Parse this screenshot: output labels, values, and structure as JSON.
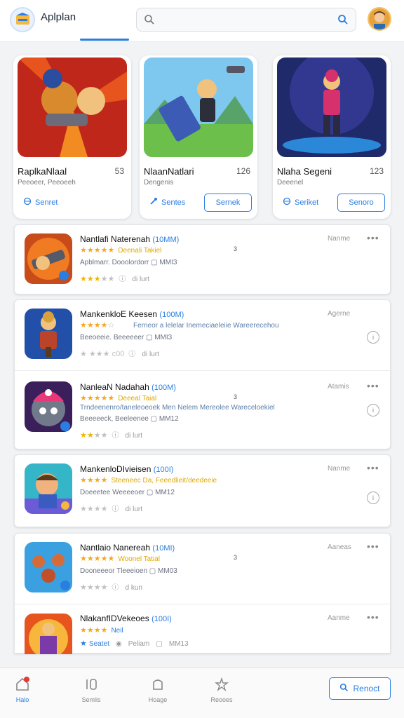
{
  "header": {
    "app_name": "Aplplan",
    "search_placeholder": ""
  },
  "featured": [
    {
      "title": "RaplkaNlaal",
      "number": "53",
      "sub": "Peeoeer, Peeoeeh",
      "link_label": "Senret",
      "button_label": ""
    },
    {
      "title": "NlaanNatlari",
      "number": "126",
      "sub": "Dengenis",
      "link_label": "Sentes",
      "button_label": "Sernek"
    },
    {
      "title": "Nlaha Segeni",
      "number": "123",
      "sub": "Deeenel",
      "link_label": "Seriket",
      "button_label": "Senoro"
    }
  ],
  "list": [
    {
      "title": "Nantlafi Naterenah",
      "title_accent": "(10MM)",
      "tag": "Nanme",
      "stars": "★★★★★",
      "highlight": "Deenali Takiel",
      "side": "3",
      "meta": "Apblmarr. Dooolordorr",
      "size": "MMI3",
      "rating_full": "★★★",
      "rating_empty": "★★",
      "rating_info": "di lurt"
    },
    {
      "title": "MankenkloE Keesen",
      "title_accent": "(100M)",
      "tag": "Agerne",
      "stars": "★★★★",
      "stars_dim": "☆",
      "desc": "Ferneor a lelelar Inemeciaeleiie Wareerecehou",
      "meta": "Beeoeeie. Beeeeeer",
      "size": "MMI3",
      "rating_full": "★",
      "rating_empty": "★★★",
      "rating_extra": "c00",
      "rating_info": "di lurt"
    },
    {
      "title": "NanleaN Nadahah",
      "title_accent": "(100M)",
      "tag": "Atamis",
      "stars": "★★★★★",
      "highlight": "Deeeal Taial",
      "side": "3",
      "desc": "Trndeenenro/taneleoeoek Men Nelem Mereolee Wareceloekiel",
      "meta": "Beeeeeck, Beeleenee",
      "size": "MM12",
      "rating_full": "★★",
      "rating_empty": "★★",
      "rating_info": "di lurt"
    },
    {
      "title": "MankenloDIvieisen",
      "title_accent": "(100I)",
      "tag": "Nanme",
      "stars": "★★★★",
      "highlight": "Steeneec Da, Feeedlieit/deedeeie",
      "meta": "Doeeetee Weeeeoer",
      "size": "MM12",
      "rating_full": "★",
      "rating_empty": "★★★",
      "rating_info": "di lurt"
    },
    {
      "title": "Nantlaio Nanereah",
      "title_accent": "(10MI)",
      "tag": "Aaneas",
      "stars": "★★★★★",
      "highlight": "Woonel Tatial",
      "side": "3",
      "meta": "Dooneeeor Tleeeioen",
      "size": "MM03",
      "rating_full": "★",
      "rating_empty": "★★★",
      "rating_info": "d kun"
    },
    {
      "title": "NlakanfIDVekeoes",
      "title_accent": "(100I)",
      "tag": "Aanme",
      "stars": "★★★★",
      "highlight": "Neil",
      "meta": "Peliam",
      "size": "MM13",
      "rating_full": "★",
      "rating_extra": "Seatet",
      "rating_info": ""
    }
  ],
  "bottom_nav": [
    {
      "label": "Halo"
    },
    {
      "label": "Semlis"
    },
    {
      "label": "Hoage"
    },
    {
      "label": "Reooes"
    }
  ],
  "fab_label": "Renoct",
  "colors": {
    "accent": "#2a7de1",
    "star": "#f5a623",
    "background": "#f2f3f5"
  }
}
